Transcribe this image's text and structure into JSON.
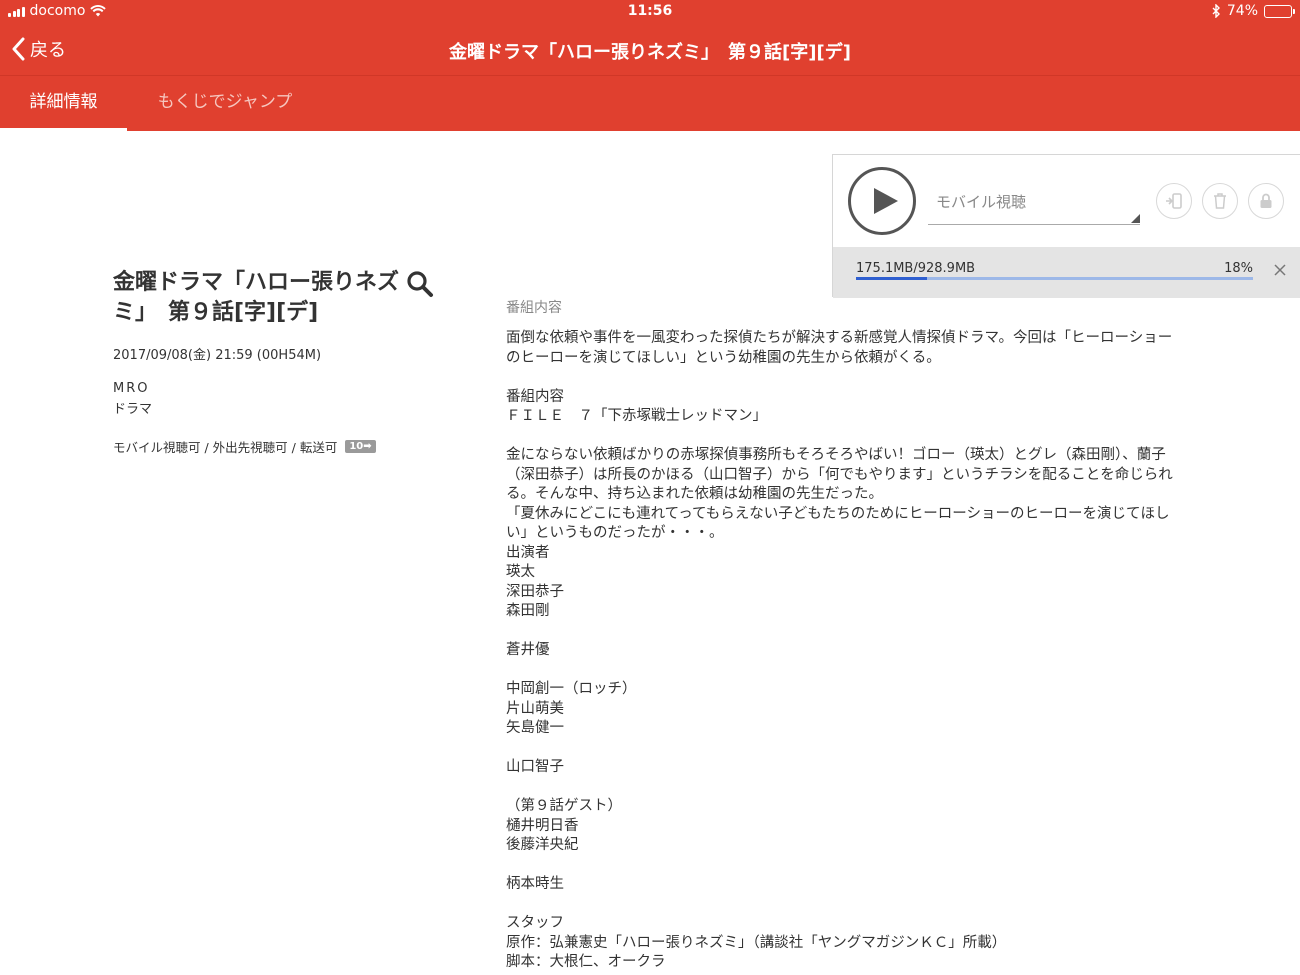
{
  "status_bar": {
    "carrier": "docomo",
    "time": "11:56",
    "battery_percent": "74%",
    "battery_level": 0.74
  },
  "nav": {
    "back_label": "戻る",
    "title": "金曜ドラマ「ハロー張りネズミ」　第９話[字][デ]"
  },
  "tabs": [
    {
      "label": "詳細情報",
      "active": true
    },
    {
      "label": "もくじでジャンプ",
      "active": false
    }
  ],
  "program": {
    "title": "金曜ドラマ「ハロー張りネズミ」　第９話[字][デ]",
    "datetime": "2017/09/08(金) 21:59 (00H54M)",
    "channel": "MRO",
    "genre": "ドラマ",
    "rights": "モバイル視聴可 / 外出先視聴可 / 転送可",
    "transfer_badge": "10➡"
  },
  "description": {
    "label": "番組内容",
    "text": "面倒な依頼や事件を一風変わった探偵たちが解決する新感覚人情探偵ドラマ。今回は「ヒーローショーのヒーローを演じてほしい」という幼稚園の先生から依頼がくる。\n\n番組内容\nＦＩＬＥ　７「下赤塚戦士レッドマン」\n\n金にならない依頼ばかりの赤塚探偵事務所もそろそろやばい！ゴロー（瑛太）とグレ（森田剛）、蘭子（深田恭子）は所長のかほる（山口智子）から「何でもやります」というチラシを配ることを命じられる。そんな中、持ち込まれた依頼は幼稚園の先生だった。\n「夏休みにどこにも連れてってもらえない子どもたちのためにヒーローショーのヒーローを演じてほしい」というものだったが・・・。\n出演者\n瑛太\n深田恭子\n森田剛\n\n蒼井優\n\n中岡創一（ロッチ）\n片山萌美\n矢島健一\n\n山口智子\n\n（第９話ゲスト）\n樋井明日香\n後藤洋央紀\n\n柄本時生\n\nスタッフ\n原作：弘兼憲史「ハロー張りネズミ」（講談社「ヤングマガジンＫＣ」所載）\n脚本：大根仁、オークラ"
  },
  "download": {
    "mode_label": "モバイル視聴",
    "size_text": "175.1MB/928.9MB",
    "percent_text": "18%",
    "progress": 0.18
  },
  "colors": {
    "accent": "#e0402f",
    "progress": "#2f5fd0"
  }
}
